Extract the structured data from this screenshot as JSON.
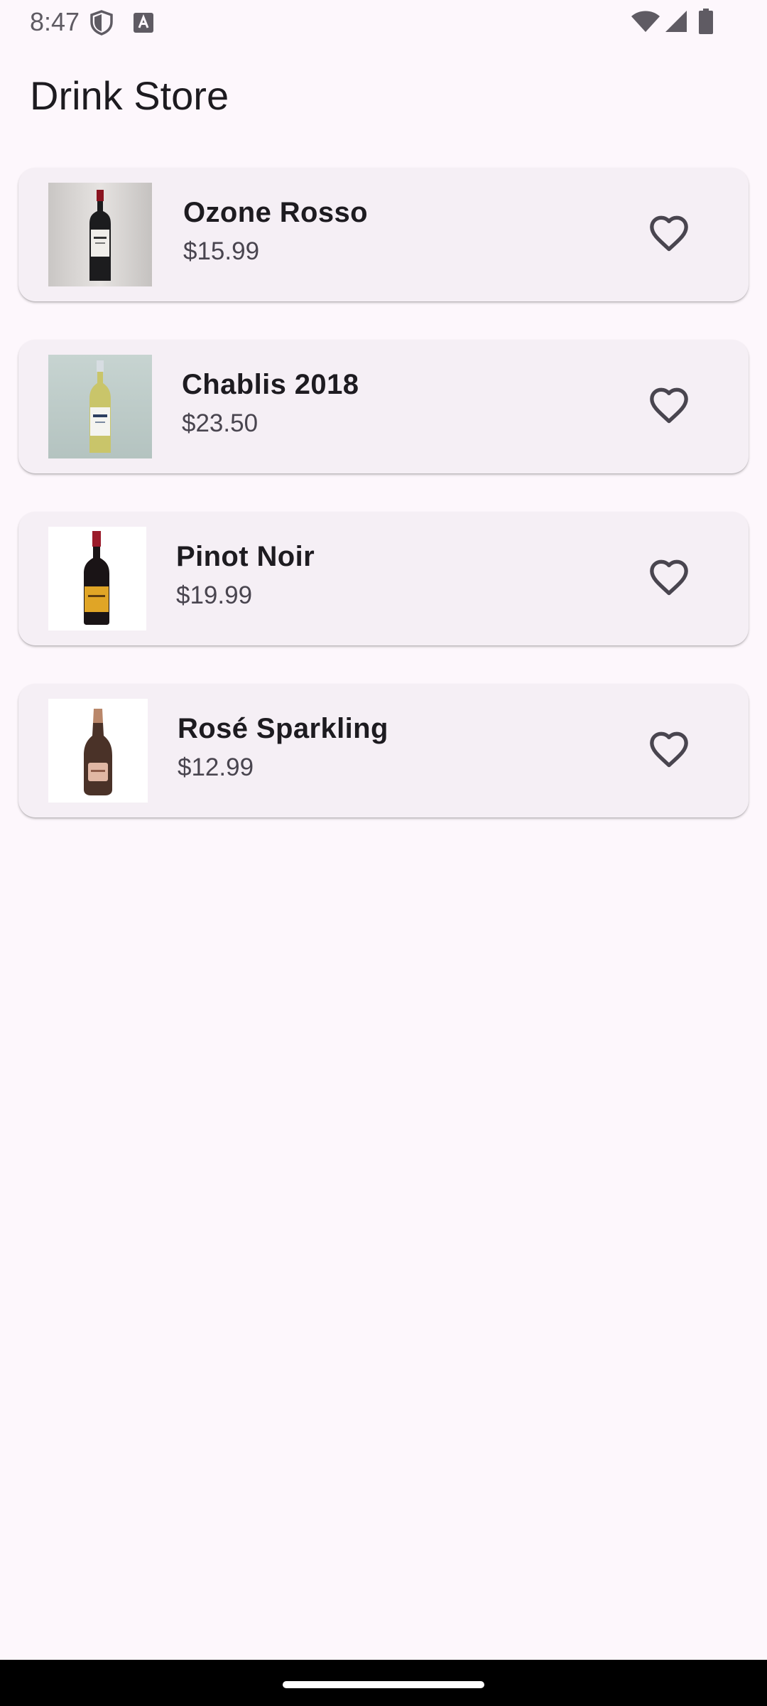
{
  "status_bar": {
    "time": "8:47",
    "icons": [
      "shield-icon",
      "text-a-icon",
      "wifi-icon",
      "signal-icon",
      "battery-icon"
    ]
  },
  "app_bar": {
    "title": "Drink Store"
  },
  "products": [
    {
      "name": "Ozone Rosso",
      "price": "$15.99",
      "image": "red-wine-bottle-image",
      "favorite": false
    },
    {
      "name": "Chablis 2018",
      "price": "$23.50",
      "image": "white-wine-bottle-image",
      "favorite": false
    },
    {
      "name": "Pinot Noir",
      "price": "$19.99",
      "image": "pinot-noir-bottle-image",
      "favorite": false
    },
    {
      "name": "Rosé Sparkling",
      "price": "$12.99",
      "image": "sparkling-rose-bottle-image",
      "favorite": false
    }
  ],
  "colors": {
    "background": "#fdf7fc",
    "card": "#f5eff5",
    "text_primary": "#1d1b20",
    "text_secondary": "#49454f"
  }
}
